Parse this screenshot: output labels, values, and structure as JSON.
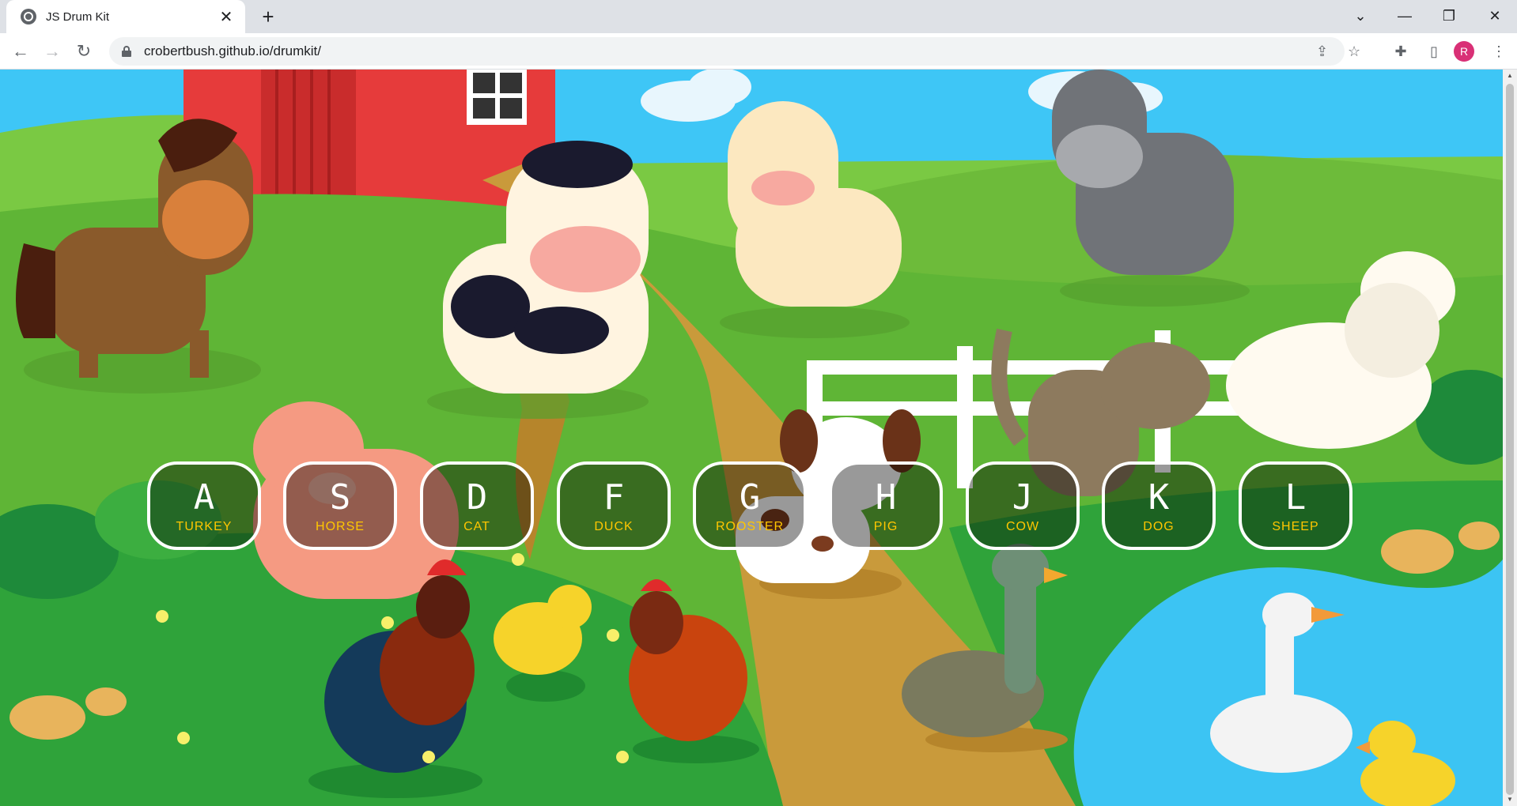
{
  "browser": {
    "tab_title": "JS Drum Kit",
    "tab_close": "✕",
    "new_tab": "+",
    "url": "crobertbush.github.io/drumkit/",
    "profile_initial": "R"
  },
  "keys": [
    {
      "key": "A",
      "sound": "TURKEY"
    },
    {
      "key": "S",
      "sound": "HORSE"
    },
    {
      "key": "D",
      "sound": "CAT"
    },
    {
      "key": "F",
      "sound": "DUCK"
    },
    {
      "key": "G",
      "sound": "ROOSTER"
    },
    {
      "key": "H",
      "sound": "PIG"
    },
    {
      "key": "J",
      "sound": "COW"
    },
    {
      "key": "K",
      "sound": "DOG"
    },
    {
      "key": "L",
      "sound": "SHEEP"
    }
  ],
  "colors": {
    "key_border": "#ffffff",
    "key_label": "#ffffff",
    "sound_label": "#ffc600",
    "sky": "#3ec6f6",
    "grass": "#7ac943",
    "barn": "#e63b3b"
  }
}
